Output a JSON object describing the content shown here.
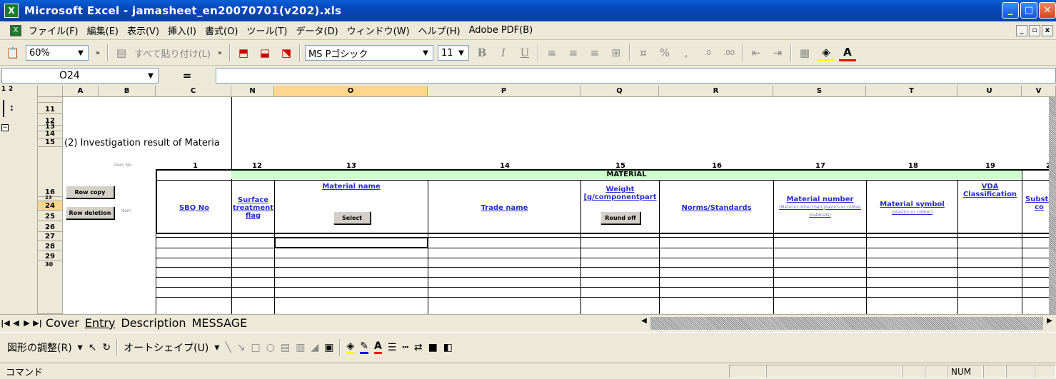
{
  "window": {
    "title": "Microsoft Excel - jamasheet_en20070701(v202).xls",
    "app_icon": "excel-icon",
    "controls": [
      "minimize",
      "maximize",
      "close"
    ]
  },
  "menu": {
    "items": [
      "ファイル(F)",
      "編集(E)",
      "表示(V)",
      "挿入(I)",
      "書式(O)",
      "ツール(T)",
      "データ(D)",
      "ウィンドウ(W)",
      "ヘルプ(H)",
      "Adobe PDF(B)"
    ]
  },
  "toolbar": {
    "zoom": "60%",
    "paste_all": "すべて貼り付け(L)",
    "font": "MS Pゴシック",
    "size": "11",
    "bold": "B",
    "italic": "I",
    "underline": "U",
    "percent": "%",
    "comma": ","
  },
  "formula_bar": {
    "name_box": "O24",
    "equals": "="
  },
  "grid": {
    "outline_levels": [
      "1",
      "2"
    ],
    "columns": [
      "A",
      "B",
      "C",
      "N",
      "O",
      "P",
      "Q",
      "R",
      "S",
      "T",
      "U",
      "V"
    ],
    "rows": [
      "11",
      "12",
      "13",
      "14",
      "15",
      "16",
      "23",
      "24",
      "25",
      "26",
      "27",
      "28",
      "29",
      "30"
    ],
    "section_title": "(2) Investigation result of Materia",
    "item_no_label": "Item No.",
    "item_label": "Item",
    "col_numbers": [
      "1",
      "12",
      "13",
      "14",
      "15",
      "16",
      "17",
      "18",
      "19",
      "2"
    ],
    "material_label": "MATERIAL",
    "headers": {
      "sbq": "SBQ No",
      "surface": "Surface treatment flag",
      "material_name": "Material name",
      "trade_name": "Trade name",
      "weight": "Weight [g/componentpart",
      "norms": "Norms/Standards",
      "material_number": "Material number",
      "material_number_sub": "(Metal or other than plastics or rubber materials)",
      "material_symbol": "Material symbol",
      "material_symbol_sub": "(plastics or rubber)",
      "vda": "VDA Classification",
      "subst": "Substa co"
    },
    "buttons": {
      "row_copy": "Row copy",
      "row_deletion": "Row deletion",
      "select": "Select",
      "round_off": "Round off"
    }
  },
  "sheets": {
    "tabs": [
      "Cover",
      "Entry",
      "Description",
      "MESSAGE"
    ],
    "active": "Entry"
  },
  "drawing": {
    "adjust": "図形の調整(R)",
    "autoshape": "オートシェイプ(U)"
  },
  "status": {
    "mode": "コマンド",
    "num": "NUM"
  }
}
